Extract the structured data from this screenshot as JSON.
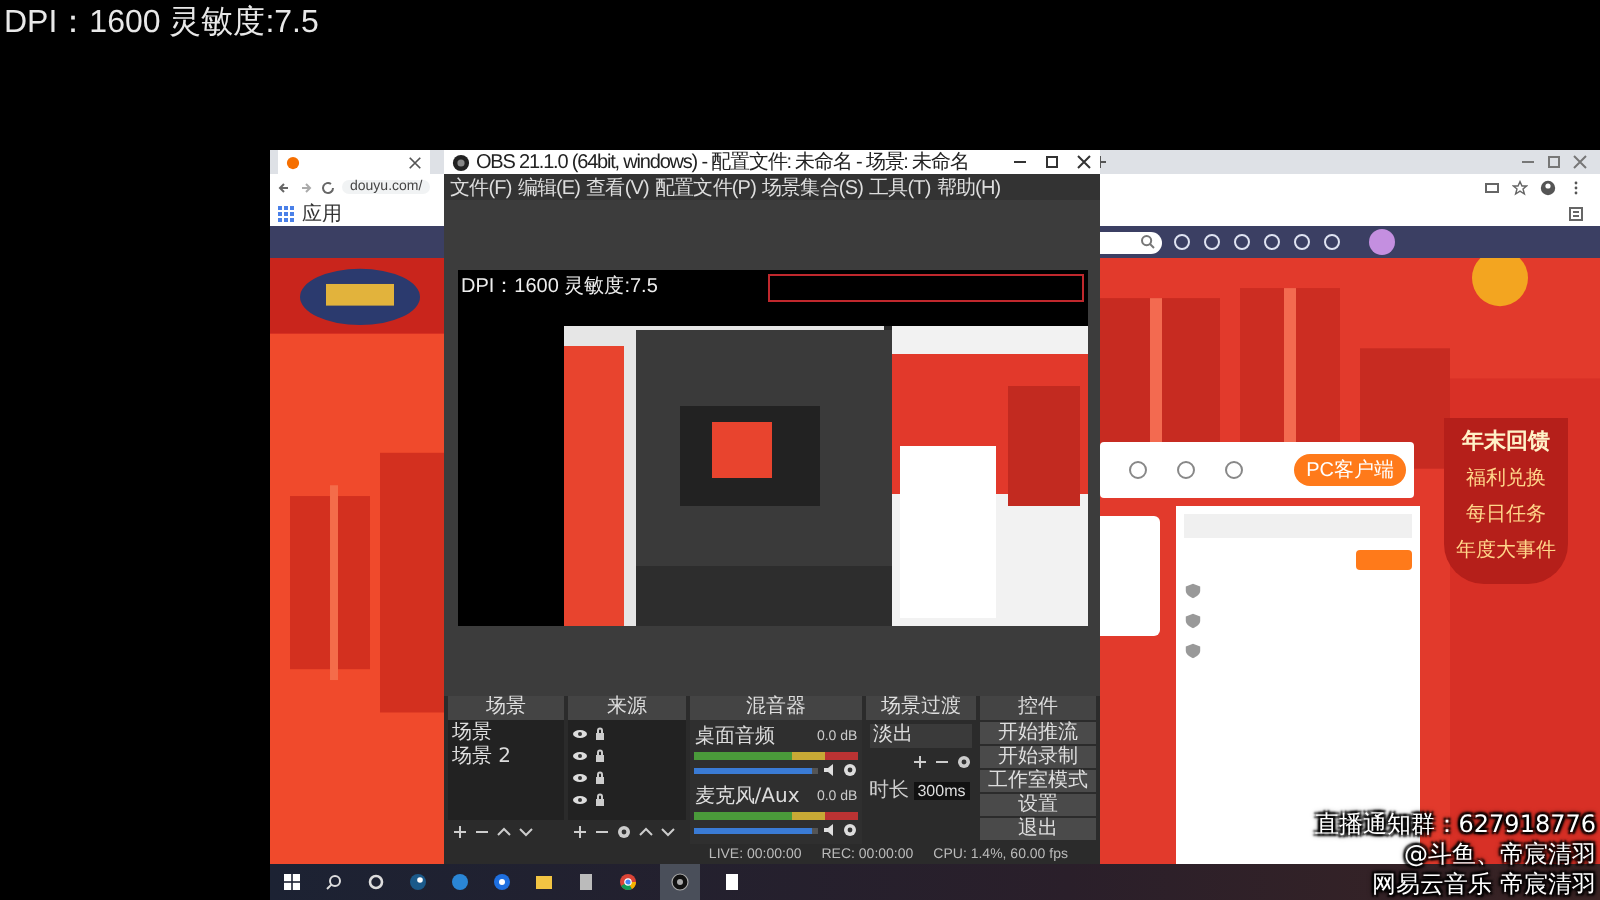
{
  "overlay": {
    "dpi_text": "DPI：1600 灵敏度:7.5",
    "notices": [
      "直播通知群：627918776",
      "@斗鱼、帝宸清羽",
      "网易云音乐 帝宸清羽"
    ]
  },
  "browser": {
    "address": "douyu.com/",
    "bookmarks": [
      "应用"
    ],
    "client_button": "PC客户端",
    "banner": {
      "title": "年末回馈",
      "items": [
        "福利兑换",
        "每日任务",
        "年度大事件"
      ]
    }
  },
  "obs": {
    "title": "OBS 21.1.0 (64bit, windows) - 配置文件: 未命名 - 场景: 未命名",
    "menu": [
      "文件(F)",
      "编辑(E)",
      "查看(V)",
      "配置文件(P)",
      "场景集合(S)",
      "工具(T)",
      "帮助(H)"
    ],
    "preview_text": "DPI：1600 灵敏度:7.5",
    "scenes": {
      "title": "场景",
      "items": [
        "场景",
        "场景 2"
      ]
    },
    "sources": {
      "title": "来源"
    },
    "mixer": {
      "title": "混音器",
      "channels": [
        {
          "name": "桌面音频",
          "reading": "0.0 dB",
          "level": 0.95
        },
        {
          "name": "麦克风/Aux",
          "reading": "0.0 dB",
          "level": 0.95
        }
      ]
    },
    "transitions": {
      "title": "场景过渡",
      "selected": "淡出",
      "duration_label": "时长",
      "duration": "300ms"
    },
    "controls": {
      "title": "控件",
      "buttons": [
        "开始推流",
        "开始录制",
        "工作室模式",
        "设置",
        "退出"
      ]
    },
    "status": [
      "LIVE: 00:00:00",
      "REC: 00:00:00",
      "CPU: 1.4%, 60.00 fps"
    ]
  }
}
